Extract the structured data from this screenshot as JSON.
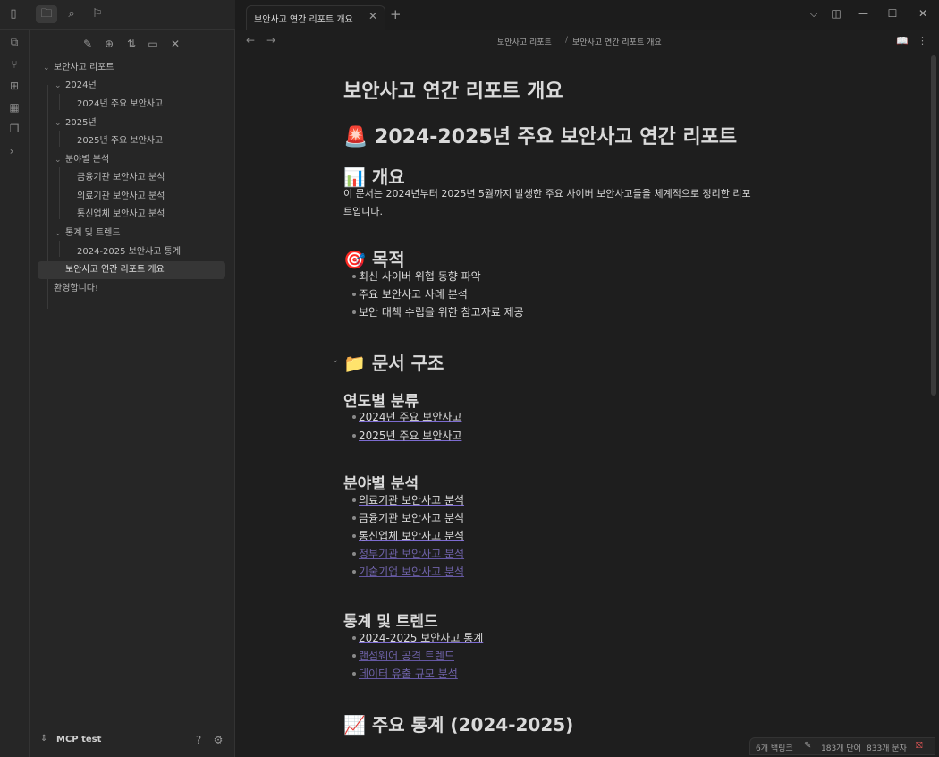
{
  "titlebar": {
    "tab_title": "보안사고 연간 리포트 개요",
    "tab_close": "✕",
    "new_tab": "+",
    "icons": [
      "sidebar-toggle-icon",
      "folder-icon",
      "search-icon",
      "bookmark-icon"
    ],
    "window_icons": {
      "dropdown": "⌵",
      "sidebar_right": "◫",
      "minimize": "—",
      "maximize": "☐",
      "close": "✕"
    }
  },
  "ribbon": {
    "icons": [
      "open-quick-switcher-icon",
      "graph-view-icon",
      "canvas-icon",
      "daily-note-icon",
      "templates-icon",
      "command-palette-icon"
    ]
  },
  "sidebar": {
    "tools": [
      "new-note-icon",
      "new-folder-icon",
      "sort-icon",
      "collapse-icon",
      "close-icon"
    ],
    "tree": {
      "root": "보안사고 리포트",
      "folder_2024": "2024년",
      "file_2024": "2024년 주요 보안사고",
      "folder_2025": "2025년",
      "file_2025": "2025년 주요 보안사고",
      "folder_sector": "분야별 분석",
      "file_finance": "금융기관 보안사고 분석",
      "file_medical": "의료기관 보안사고 분석",
      "file_telecom": "통신업체 보안사고 분석",
      "folder_stats": "통계 및 트렌드",
      "file_stats": "2024-2025 보안사고 통계",
      "file_overview": "보안사고 연간 리포트 개요",
      "file_welcome": "환영합니다!"
    },
    "vault_name": "MCP test",
    "help": "?",
    "settings": "⚙"
  },
  "viewheader": {
    "back": "←",
    "forward": "→",
    "crumb_folder": "보안사고 리포트",
    "crumb_sep": "/",
    "crumb_file": "보안사고 연간 리포트 개요",
    "reading_icon": "📖",
    "more_icon": "⋮"
  },
  "document": {
    "title": "보안사고 연간 리포트 개요",
    "h1": "🚨 2024-2025년 주요 보안사고 연간 리포트",
    "overview_heading": "📊 개요",
    "overview_line1": "이 문서는 2024년부터 2025년 5월까지 발생한 주요 사이버 보안사고들을 체계적으로 정리한 리포",
    "overview_line2": "트입니다.",
    "purpose_heading": "🎯 목적",
    "purpose_items": [
      "최신 사이버 위협 동향 파악",
      "주요 보안사고 사례 분석",
      "보안 대책 수립을 위한 참고자료 제공"
    ],
    "structure_heading": "📁 문서 구조",
    "by_year_heading": "연도별 분류",
    "by_year_links": [
      "2024년 주요 보안사고",
      "2025년 주요 보안사고"
    ],
    "by_sector_heading": "분야별 분석",
    "by_sector_links": [
      "의료기관 보안사고 분석",
      "금융기관 보안사고 분석",
      "통신업체 보안사고 분석",
      "정부기관 보안사고 분석",
      "기술기업 보안사고 분석"
    ],
    "stats_heading": "통계 및 트렌드",
    "stats_links": [
      "2024-2025 보안사고 통계",
      "랜섬웨어 공격 트렌드",
      "데이터 유출 규모 분석"
    ],
    "key_stats_heading": "📈 주요 통계 (2024-2025)"
  },
  "statusbar": {
    "backlinks": "6개 백링크",
    "words": "183개 단어",
    "chars": "833개 문자"
  },
  "colors": {
    "link": "#a78bfa",
    "background": "#1e1e1e",
    "sidebar": "#262626"
  }
}
